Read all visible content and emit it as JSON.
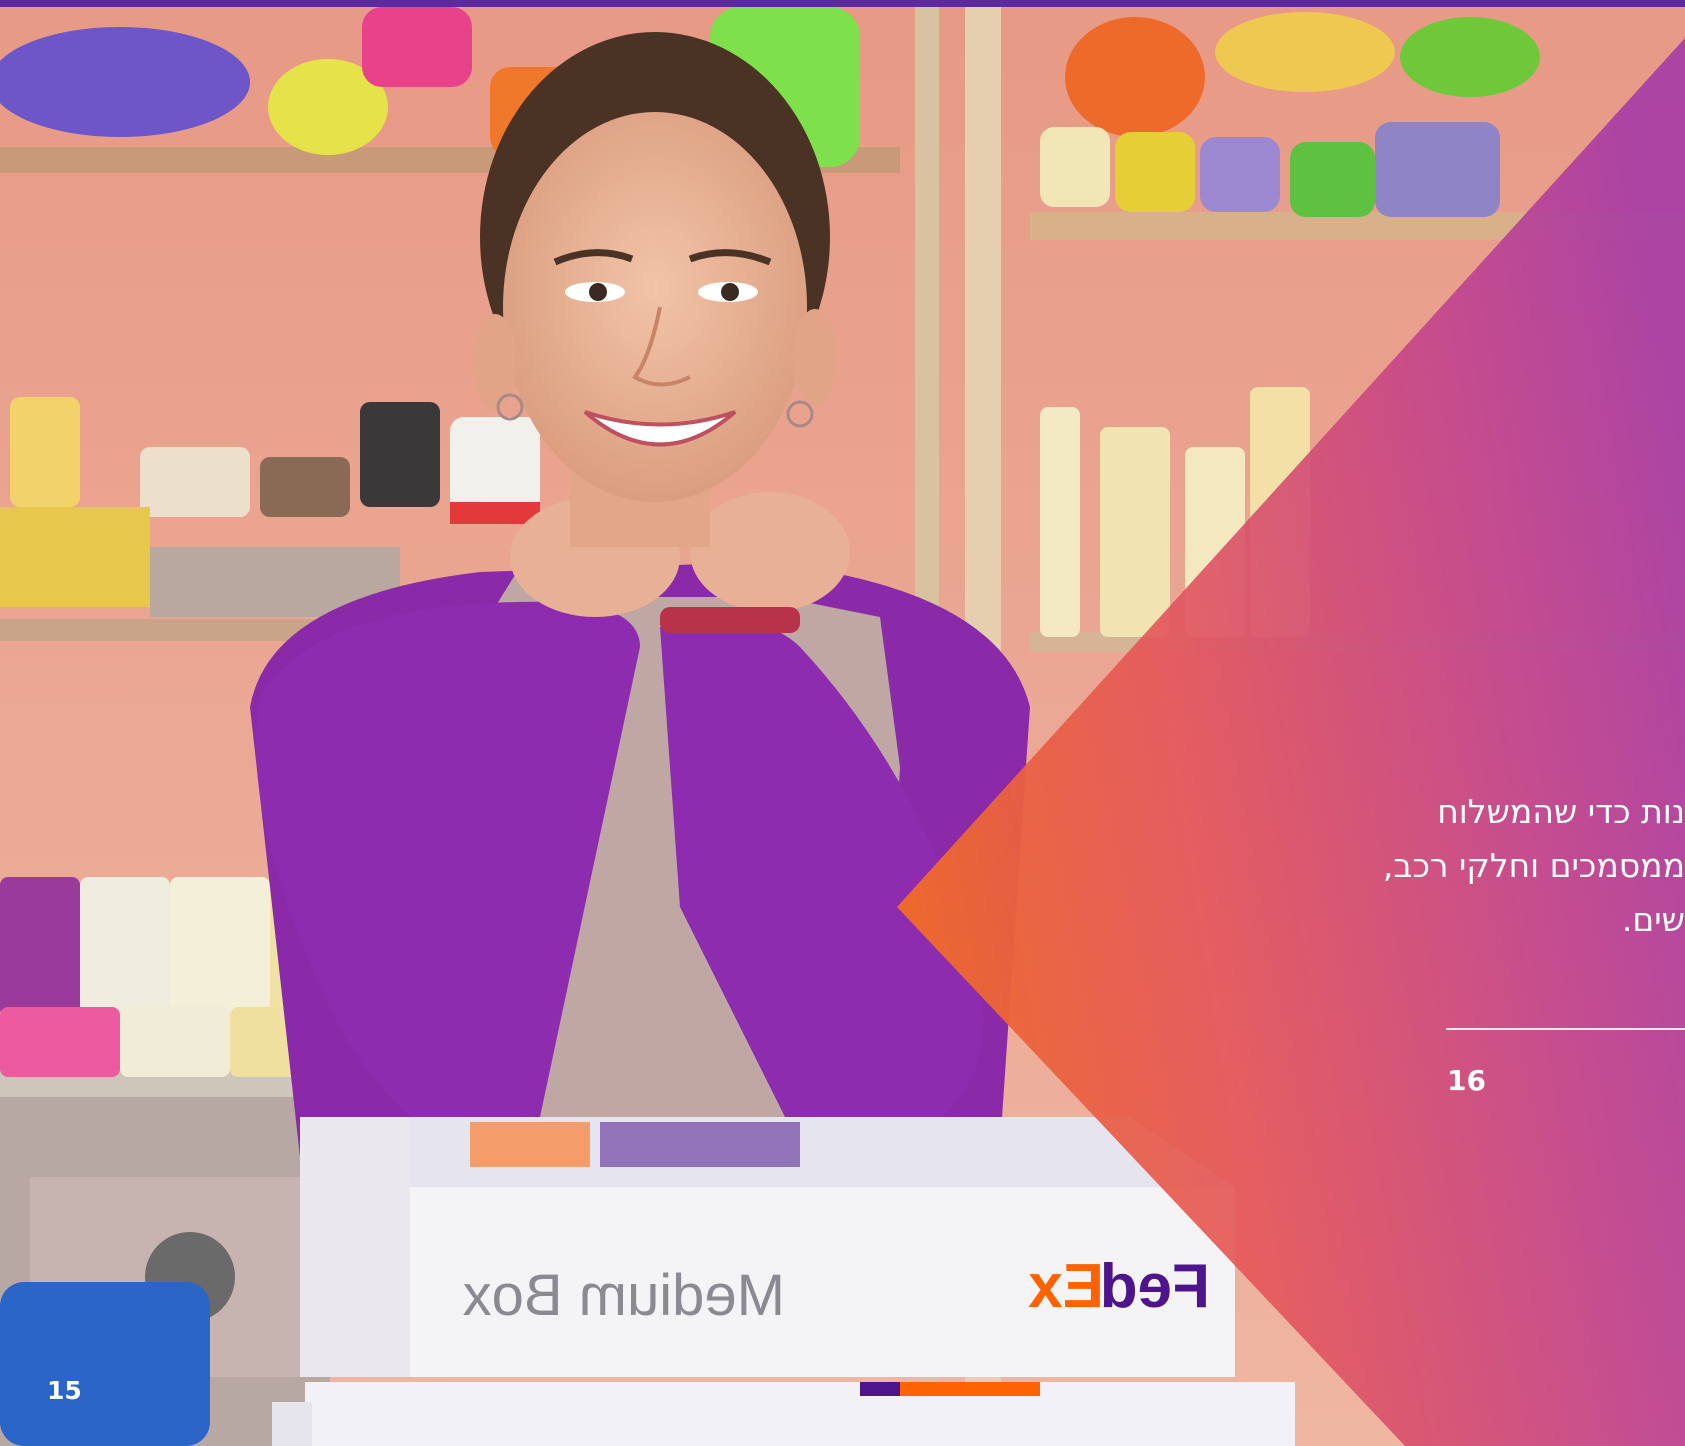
{
  "pages": {
    "left_page_number": "15",
    "right_page_number": "16"
  },
  "body": {
    "line_1": "נות כדי שהמשלוח",
    "line_2": "ממסמכים וחלקי רכב,",
    "line_3": "שים."
  },
  "photo": {
    "box_label": "Medium Box",
    "brand_fed": "Fed",
    "brand_ex": "Ex"
  },
  "colors": {
    "fedex_purple": "#4d148c",
    "fedex_orange": "#ff6200",
    "gradient_orange": "#ef6a2a",
    "gradient_magenta": "#b0399e",
    "top_bar": "#5b2a9e"
  }
}
